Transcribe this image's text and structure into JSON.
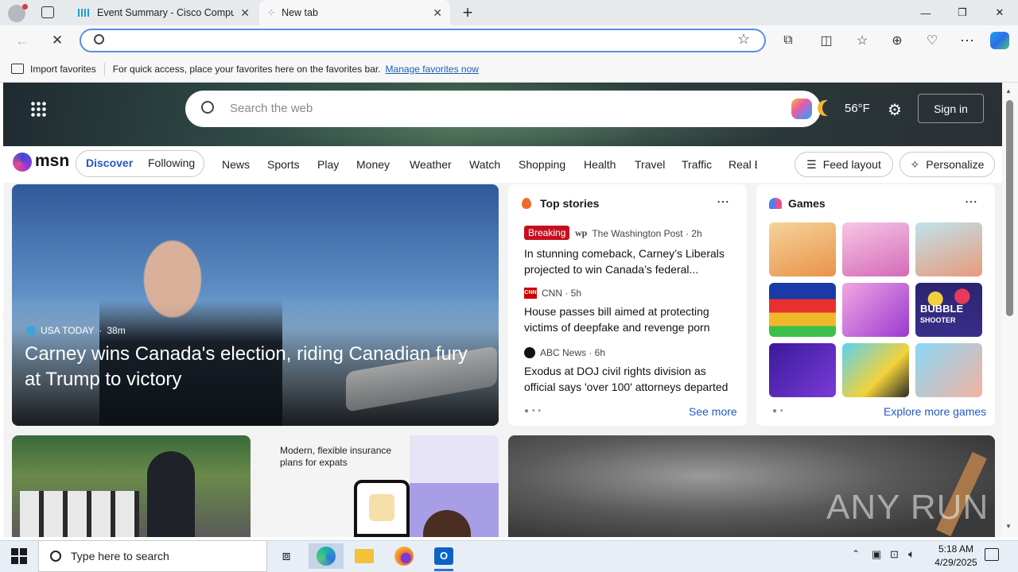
{
  "browser": {
    "tabs": [
      {
        "label": "Event Summary - Cisco Compute",
        "active": false
      },
      {
        "label": "New tab",
        "active": true
      }
    ],
    "new_tab_label": "+",
    "address_value": "",
    "favorites_bar": {
      "import_label": "Import favorites",
      "hint": "For quick access, place your favorites here on the favorites bar.",
      "manage_link": "Manage favorites now"
    }
  },
  "msn": {
    "search_placeholder": "Search the web",
    "temperature": "56°F",
    "signin_label": "Sign in",
    "logo": "msn",
    "tabs": {
      "discover": "Discover",
      "following": "Following"
    },
    "nav": [
      "News",
      "Sports",
      "Play",
      "Money",
      "Weather",
      "Watch",
      "Shopping",
      "Health",
      "Travel",
      "Traffic",
      "Real E"
    ],
    "feed_layout_label": "Feed layout",
    "personalize_label": "Personalize"
  },
  "hero_story": {
    "source": "USA TODAY",
    "age": "38m",
    "title": "Carney wins Canada's election, riding Canadian fury at Trump to victory"
  },
  "top_stories": {
    "header": "Top stories",
    "items": [
      {
        "badge": "Breaking",
        "source": "The Washington Post · 2h",
        "title": "In stunning comeback, Carney’s Liberals projected to win Canada’s federal..."
      },
      {
        "badge": "",
        "source": "CNN · 5h",
        "title": "House passes bill aimed at protecting victims of deepfake and revenge porn"
      },
      {
        "badge": "",
        "source": "ABC News · 6h",
        "title": "Exodus at DOJ civil rights division as official says 'over 100' attorneys departed"
      }
    ],
    "see_more": "See more"
  },
  "games": {
    "header": "Games",
    "explore": "Explore more games",
    "tiles": [
      {
        "name": "cafe-game",
        "color": "#f0b36a"
      },
      {
        "name": "dressup-game",
        "color": "#e89ad3"
      },
      {
        "name": "hospital-game",
        "color": "#8fc7d8"
      },
      {
        "name": "block-puzzle-game",
        "color": "#1f4fb8"
      },
      {
        "name": "makeup-game",
        "color": "#c86bd6"
      },
      {
        "name": "bubble-shooter-game",
        "color": "#3a2e8a"
      },
      {
        "name": "rocket-game",
        "color": "#5a2ab8"
      },
      {
        "name": "cube-game",
        "color": "#39c2e8"
      },
      {
        "name": "nail-game",
        "color": "#79c9f0"
      }
    ]
  },
  "ad_card": {
    "text": "Modern, flexible insurance plans for expats"
  },
  "watermark": "ANY RUN",
  "taskbar": {
    "search_placeholder": "Type here to search",
    "time": "5:18 AM",
    "date": "4/29/2025"
  }
}
